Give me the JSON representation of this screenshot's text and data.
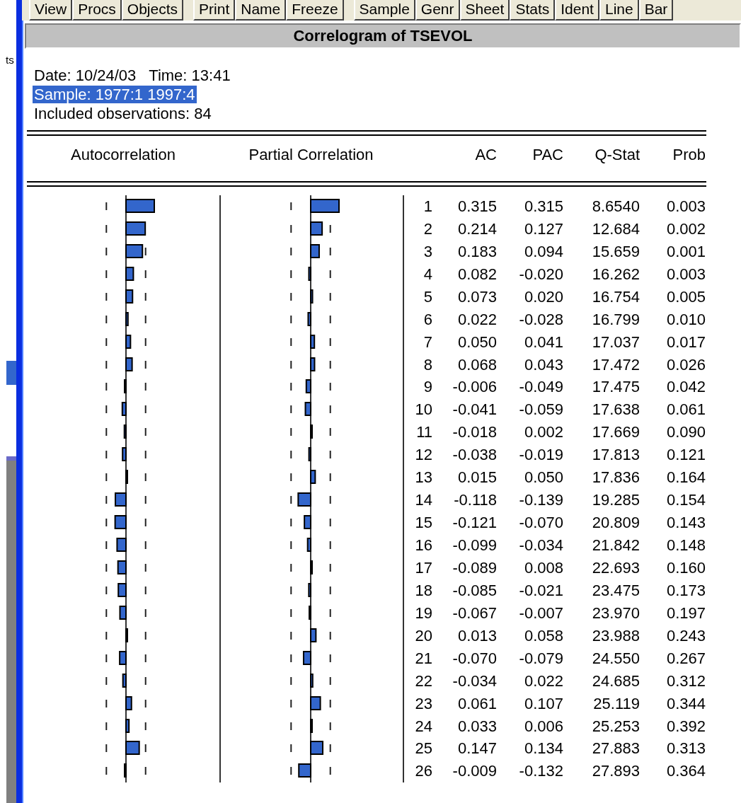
{
  "background_fragment": "ts",
  "toolbar": [
    {
      "buttons": [
        "View",
        "Procs",
        "Objects"
      ]
    },
    {
      "buttons": [
        "Print",
        "Name",
        "Freeze"
      ]
    },
    {
      "buttons": [
        "Sample",
        "Genr",
        "Sheet",
        "Stats",
        "Ident",
        "Line",
        "Bar"
      ]
    }
  ],
  "window": {
    "title": "Correlogram of TSEVOL"
  },
  "info": [
    {
      "text": "Date: 10/24/03   Time: 13:41",
      "selected": false
    },
    {
      "text": "Sample: 1977:1 1997:4",
      "selected": true
    },
    {
      "text": "Included observations: 84",
      "selected": false
    }
  ],
  "table": {
    "columns": [
      "Autocorrelation",
      "Partial Correlation",
      "",
      "AC",
      "PAC",
      "Q-Stat",
      "Prob"
    ],
    "rows": [
      [
        "",
        "",
        "1",
        "0.315",
        "0.315",
        "8.6540",
        "0.003"
      ],
      [
        "",
        "",
        "2",
        "0.214",
        "0.127",
        "12.684",
        "0.002"
      ],
      [
        "",
        "",
        "3",
        "0.183",
        "0.094",
        "15.659",
        "0.001"
      ],
      [
        "",
        "",
        "4",
        "0.082",
        "-0.020",
        "16.262",
        "0.003"
      ],
      [
        "",
        "",
        "5",
        "0.073",
        "0.020",
        "16.754",
        "0.005"
      ],
      [
        "",
        "",
        "6",
        "0.022",
        "-0.028",
        "16.799",
        "0.010"
      ],
      [
        "",
        "",
        "7",
        "0.050",
        "0.041",
        "17.037",
        "0.017"
      ],
      [
        "",
        "",
        "8",
        "0.068",
        "0.043",
        "17.472",
        "0.026"
      ],
      [
        "",
        "",
        "9",
        "-0.006",
        "-0.049",
        "17.475",
        "0.042"
      ],
      [
        "",
        "",
        "10",
        "-0.041",
        "-0.059",
        "17.638",
        "0.061"
      ],
      [
        "",
        "",
        "11",
        "-0.018",
        "0.002",
        "17.669",
        "0.090"
      ],
      [
        "",
        "",
        "12",
        "-0.038",
        "-0.019",
        "17.813",
        "0.121"
      ],
      [
        "",
        "",
        "13",
        "0.015",
        "0.050",
        "17.836",
        "0.164"
      ],
      [
        "",
        "",
        "14",
        "-0.118",
        "-0.139",
        "19.285",
        "0.154"
      ],
      [
        "",
        "",
        "15",
        "-0.121",
        "-0.070",
        "20.809",
        "0.143"
      ],
      [
        "",
        "",
        "16",
        "-0.099",
        "-0.034",
        "21.842",
        "0.148"
      ],
      [
        "",
        "",
        "17",
        "-0.089",
        "0.008",
        "22.693",
        "0.160"
      ],
      [
        "",
        "",
        "18",
        "-0.085",
        "-0.021",
        "23.475",
        "0.173"
      ],
      [
        "",
        "",
        "19",
        "-0.067",
        "-0.007",
        "23.970",
        "0.197"
      ],
      [
        "",
        "",
        "20",
        "0.013",
        "0.058",
        "23.988",
        "0.243"
      ],
      [
        "",
        "",
        "21",
        "-0.070",
        "-0.079",
        "24.550",
        "0.267"
      ],
      [
        "",
        "",
        "22",
        "-0.034",
        "0.022",
        "24.685",
        "0.312"
      ],
      [
        "",
        "",
        "23",
        "0.061",
        "0.107",
        "25.119",
        "0.344"
      ],
      [
        "",
        "",
        "24",
        "0.033",
        "0.006",
        "25.253",
        "0.392"
      ],
      [
        "",
        "",
        "25",
        "0.147",
        "0.134",
        "27.883",
        "0.313"
      ],
      [
        "",
        "",
        "26",
        "-0.009",
        "-0.132",
        "27.893",
        "0.364"
      ]
    ]
  }
}
